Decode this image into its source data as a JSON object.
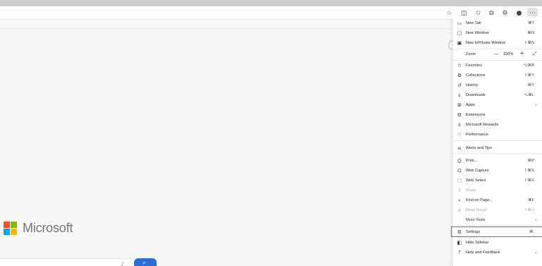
{
  "toolbar": {
    "icons": [
      "favorites-add-icon",
      "split-screen-icon",
      "favorites-icon",
      "collections-icon",
      "extensions-icon",
      "profile-icon",
      "more-icon"
    ]
  },
  "page": {
    "brand": "Microsoft"
  },
  "menu": {
    "items": [
      {
        "label": "New Tab",
        "shortcut": "⌘T",
        "icon": "new-tab-icon"
      },
      {
        "label": "New Window",
        "shortcut": "⌘N",
        "icon": "new-window-icon"
      },
      {
        "label": "New InPrivate Window",
        "shortcut": "⇧⌘N",
        "icon": "inprivate-icon"
      },
      {
        "label": "Favorites",
        "shortcut": "⌥⌘B",
        "icon": "favorites-icon"
      },
      {
        "label": "Collections",
        "shortcut": "⇧⌘Y",
        "icon": "collections-icon"
      },
      {
        "label": "History",
        "shortcut": "⌘Y",
        "icon": "history-icon"
      },
      {
        "label": "Downloads",
        "shortcut": "⌥⌘L",
        "icon": "download-icon"
      },
      {
        "label": "Apps",
        "shortcut": "",
        "icon": "apps-icon"
      },
      {
        "label": "Extensions",
        "shortcut": "",
        "icon": "extensions-icon"
      },
      {
        "label": "Microsoft Rewards",
        "shortcut": "",
        "icon": "rewards-icon"
      },
      {
        "label": "Performance",
        "shortcut": "",
        "icon": "performance-icon"
      },
      {
        "label": "Alerts and Tips",
        "shortcut": "",
        "icon": "bell-icon"
      },
      {
        "label": "Print...",
        "shortcut": "⌘P",
        "icon": "print-icon"
      },
      {
        "label": "Web Capture",
        "shortcut": "⇧⌘S",
        "icon": "web-capture-icon"
      },
      {
        "label": "Web Select",
        "shortcut": "⇧⌘X",
        "icon": "web-select-icon"
      },
      {
        "label": "Share",
        "shortcut": "",
        "icon": "share-icon"
      },
      {
        "label": "Find on Page...",
        "shortcut": "⌘F",
        "icon": "find-icon"
      },
      {
        "label": "Read Aloud",
        "shortcut": "⇧⌘U",
        "icon": "read-aloud-icon"
      },
      {
        "label": "More Tools",
        "shortcut": "",
        "icon": ""
      },
      {
        "label": "Settings",
        "shortcut": "⌘,",
        "icon": "gear-icon"
      },
      {
        "label": "Hide Sidebar",
        "shortcut": "",
        "icon": "sidebar-icon"
      },
      {
        "label": "Help and Feedback",
        "shortcut": "",
        "icon": "help-icon"
      }
    ],
    "zoom": {
      "label": "Zoom",
      "value": "100%",
      "minus": "—",
      "plus": "+"
    }
  }
}
